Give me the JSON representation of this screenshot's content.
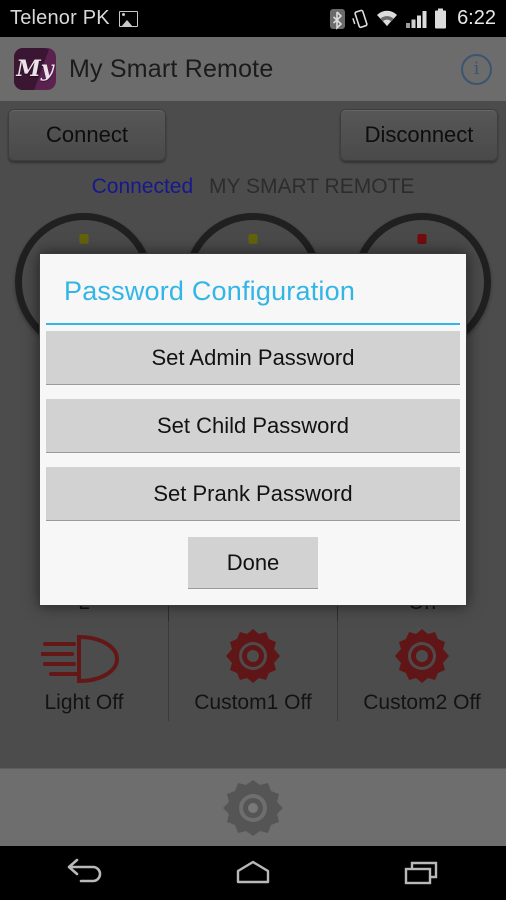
{
  "status_bar": {
    "carrier": "Telenor PK",
    "clock": "6:22",
    "icons": [
      "photo-icon",
      "bluetooth-icon",
      "vibrate-icon",
      "wifi-icon",
      "cell-signal-icon",
      "battery-icon"
    ]
  },
  "action_bar": {
    "logo_text": "My",
    "title": "My Smart Remote",
    "info_icon": "info-icon",
    "info_glyph": "i"
  },
  "app": {
    "connect_label": "Connect",
    "disconnect_label": "Disconnect",
    "status_connected": "Connected",
    "device_name": "MY SMART REMOTE",
    "tiles": [
      {
        "label": "Light Off",
        "icon": "headlight-icon"
      },
      {
        "label": "Custom1 Off",
        "icon": "gear-icon"
      },
      {
        "label": "Custom2 Off",
        "icon": "gear-icon"
      }
    ],
    "hidden_left_label": "L",
    "hidden_right_label": "On",
    "settings_icon": "settings-gear-icon"
  },
  "dialog": {
    "title": "Password Configuration",
    "accent_color": "#33b5e5",
    "buttons": [
      {
        "label": "Set Admin Password"
      },
      {
        "label": "Set Child Password"
      },
      {
        "label": "Set Prank Password"
      }
    ],
    "done_label": "Done"
  },
  "nav_bar": {
    "back": "back-icon",
    "home": "home-icon",
    "recents": "recents-icon"
  }
}
